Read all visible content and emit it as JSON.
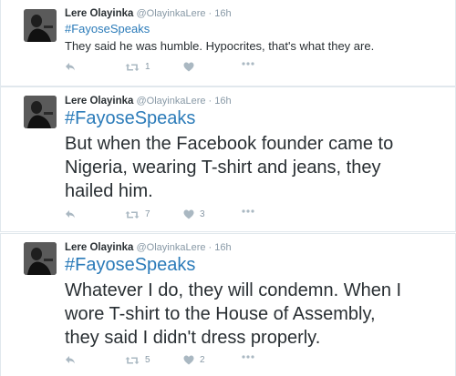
{
  "tweets": [
    {
      "name": "Lere Olayinka",
      "handle": "@OlayinkaLere",
      "dot": "·",
      "time": "16h",
      "hashtag": "#FayoseSpeaks",
      "text": "They said he was humble. Hypocrites,  that's what they are.",
      "retweets": "1",
      "likes": ""
    },
    {
      "name": "Lere Olayinka",
      "handle": "@OlayinkaLere",
      "dot": "·",
      "time": "16h",
      "hashtag": "#FayoseSpeaks",
      "text": "But when the Facebook founder  came to\nNigeria, wearing T-shirt and jeans, they\nhailed him.",
      "retweets": "7",
      "likes": "3"
    },
    {
      "name": "Lere Olayinka",
      "handle": "@OlayinkaLere",
      "dot": "·",
      "time": "16h",
      "hashtag": "#FayoseSpeaks",
      "text": "Whatever I do, they will condemn. When I\nwore T-shirt to the House of Assembly,\nthey said I didn't dress properly.",
      "retweets": "5",
      "likes": "2"
    }
  ],
  "icons": {
    "reply": "reply-icon",
    "retweet": "retweet-icon",
    "like": "heart-icon",
    "more": "more-icon"
  },
  "colors": {
    "hashtag": "#2b7bb9",
    "muted": "#8899a6",
    "icon": "#aab8c2",
    "border": "#e1e8ed"
  }
}
